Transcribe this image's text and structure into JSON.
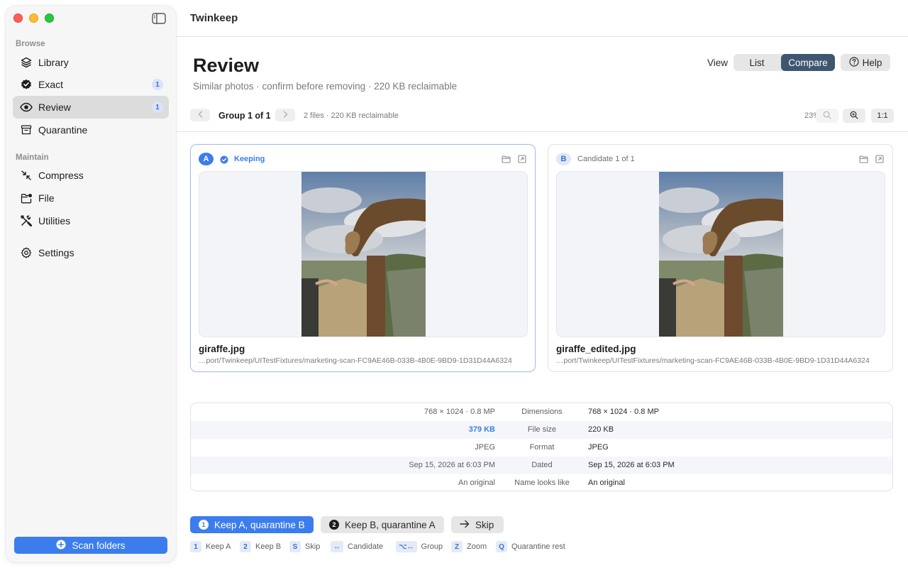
{
  "window": {
    "app_title": "Twinkeep"
  },
  "sidebar": {
    "sections": [
      {
        "label": "Browse"
      },
      {
        "label": "Maintain"
      }
    ],
    "items": [
      {
        "label": "Library",
        "icon": "layers-icon",
        "badge": ""
      },
      {
        "label": "Exact",
        "icon": "verified-badge-icon",
        "badge": "1"
      },
      {
        "label": "Review",
        "icon": "eye-icon",
        "badge": "1",
        "active": true
      },
      {
        "label": "Quarantine",
        "icon": "archive-icon",
        "badge": ""
      },
      {
        "label": "Compress",
        "icon": "compress-arrows-icon",
        "badge": ""
      },
      {
        "label": "File",
        "icon": "folder-badge-icon",
        "badge": ""
      },
      {
        "label": "Utilities",
        "icon": "tools-icon",
        "badge": ""
      },
      {
        "label": "Settings",
        "icon": "gear-icon",
        "badge": ""
      }
    ],
    "scan_button": "Scan folders"
  },
  "header": {
    "title": "Review",
    "subtitle": "Similar photos · confirm before removing · 220 KB reclaimable",
    "view_label": "View",
    "view_options": [
      "List",
      "Compare"
    ],
    "view_selected": "Compare",
    "help_label": "Help"
  },
  "group_bar": {
    "label": "Group 1 of 1",
    "meta": "2 files · 220 KB reclaimable",
    "zoom_percent": "23%",
    "one_to_one": "1:1"
  },
  "cards": [
    {
      "letter": "A",
      "status": "Keeping",
      "file_name": "giraffe.jpg",
      "path": "…port/Twinkeep/UITestFixtures/marketing-scan-FC9AE46B-033B-4B0E-9BD9-1D31D44A6324"
    },
    {
      "letter": "B",
      "status": "Candidate 1 of 1",
      "file_name": "giraffe_edited.jpg",
      "path": "…port/Twinkeep/UITestFixtures/marketing-scan-FC9AE46B-033B-4B0E-9BD9-1D31D44A6324"
    }
  ],
  "metadata": {
    "rows": [
      {
        "left": "768 × 1024 · 0.8 MP",
        "label": "Dimensions",
        "right": "768 × 1024 · 0.8 MP"
      },
      {
        "left": "379 KB",
        "label": "File size",
        "right": "220 KB"
      },
      {
        "left": "JPEG",
        "label": "Format",
        "right": "JPEG"
      },
      {
        "left": "Sep 15, 2026 at 6:03 PM",
        "label": "Dated",
        "right": "Sep 15, 2026 at 6:03 PM"
      },
      {
        "left": "An original",
        "label": "Name looks like",
        "right": "An original"
      }
    ]
  },
  "actions": {
    "keep_a": {
      "num": "1",
      "label": "Keep A, quarantine B"
    },
    "keep_b": {
      "num": "2",
      "label": "Keep B, quarantine A"
    },
    "skip": {
      "label": "Skip"
    }
  },
  "shortcuts": [
    {
      "key": "1",
      "label": "Keep A"
    },
    {
      "key": "2",
      "label": "Keep B"
    },
    {
      "key": "S",
      "label": "Skip"
    },
    {
      "key": "↔",
      "label": "Candidate"
    },
    {
      "key": "⌥↔",
      "label": "Group"
    },
    {
      "key": "Z",
      "label": "Zoom"
    },
    {
      "key": "Q",
      "label": "Quarantine rest"
    }
  ],
  "colors": {
    "accent": "#3b7ded",
    "segment_selected": "#3f5670",
    "badge_bg": "#d9e4f8"
  }
}
